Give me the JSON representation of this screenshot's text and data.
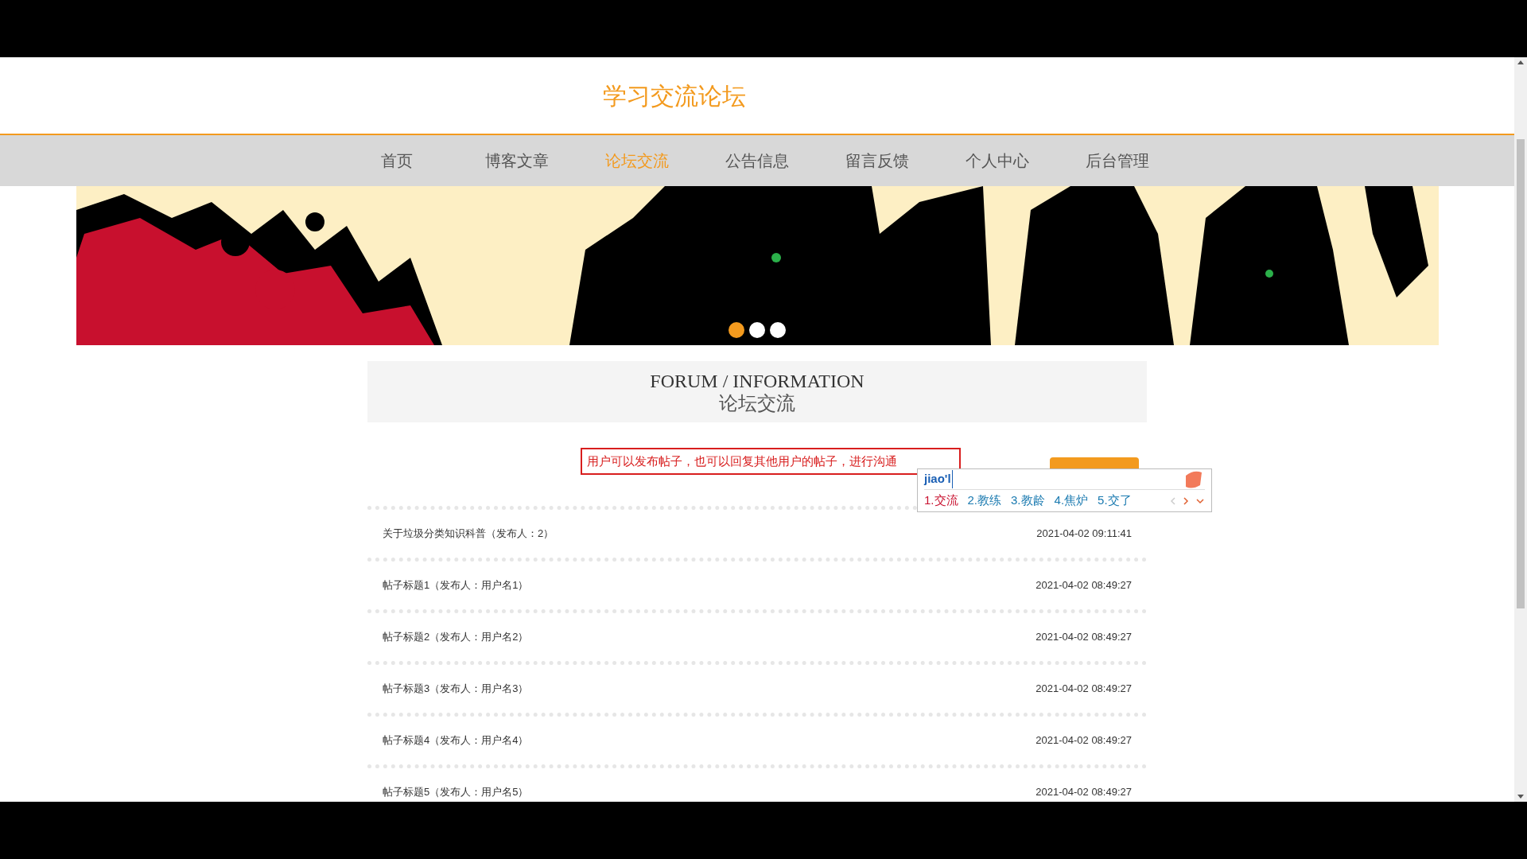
{
  "site_title": "学习交流论坛",
  "nav": [
    {
      "label": "首页",
      "selected": false
    },
    {
      "label": "博客文章",
      "selected": false
    },
    {
      "label": "论坛交流",
      "selected": true
    },
    {
      "label": "公告信息",
      "selected": false
    },
    {
      "label": "留言反馈",
      "selected": false
    },
    {
      "label": "个人中心",
      "selected": false
    },
    {
      "label": "后台管理",
      "selected": false
    }
  ],
  "banner": {
    "dots": [
      {
        "selected": true
      },
      {
        "selected": false
      },
      {
        "selected": false
      }
    ]
  },
  "section_header": {
    "title": "FORUM / INFORMATION",
    "subtitle": "论坛交流"
  },
  "search": {
    "value": "用户可以发布帖子，也可以回复其他用户的帖子，进行沟通"
  },
  "ime_popup": {
    "input": "jiao'l",
    "candidates": [
      {
        "label": "1.交流",
        "selected": true
      },
      {
        "label": "2.教练",
        "selected": false
      },
      {
        "label": "3.教龄",
        "selected": false
      },
      {
        "label": "4.焦炉",
        "selected": false
      },
      {
        "label": "5.交了",
        "selected": false
      }
    ]
  },
  "posts": [
    {
      "title": "关于垃圾分类知识科普（发布人：2）",
      "time": "2021-04-02 09:11:41"
    },
    {
      "title": "帖子标题1（发布人：用户名1）",
      "time": "2021-04-02 08:49:27"
    },
    {
      "title": "帖子标题2（发布人：用户名2）",
      "time": "2021-04-02 08:49:27"
    },
    {
      "title": "帖子标题3（发布人：用户名3）",
      "time": "2021-04-02 08:49:27"
    },
    {
      "title": "帖子标题4（发布人：用户名4）",
      "time": "2021-04-02 08:49:27"
    },
    {
      "title": "帖子标题5（发布人：用户名5）",
      "time": "2021-04-02 08:49:27"
    }
  ]
}
